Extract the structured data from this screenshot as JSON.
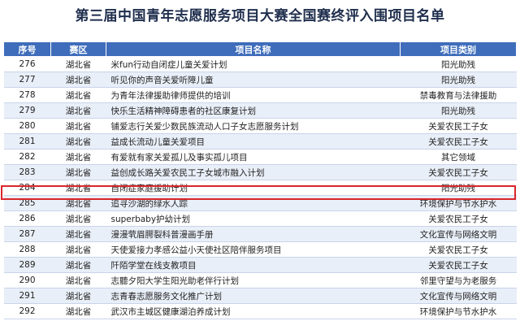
{
  "page": {
    "title": "第三届中国青年志愿服务项目大赛全国赛终评入围项目名单"
  },
  "table": {
    "headers": [
      "序号",
      "赛区",
      "项目名称",
      "项目类别"
    ],
    "rows": [
      [
        "276",
        "湖北省",
        "米fun行动自闭症儿童关爱计划",
        "阳光助残"
      ],
      [
        "277",
        "湖北省",
        "听见你的声音关爱听障儿童",
        "阳光助残"
      ],
      [
        "278",
        "湖北省",
        "为青年法律援助律师提供的培训",
        "禁毒教育与法律援助"
      ],
      [
        "279",
        "湖北省",
        "快乐生活精神障碍患者的社区康复计划",
        "阳光助残"
      ],
      [
        "280",
        "湖北省",
        "铺爱志行关爱少数民族流动人口子女志愿服务计划",
        "关爱农民工子女"
      ],
      [
        "281",
        "湖北省",
        "益成长流动儿童关爱项目",
        "关爱农民工子女"
      ],
      [
        "282",
        "湖北省",
        "有爱就有家关爱孤儿及事实孤儿项目",
        "其它领域"
      ],
      [
        "283",
        "湖北省",
        "益创成长路关爱农民工子女城市融入计划",
        "关爱农民工子女"
      ],
      [
        "284",
        "湖北省",
        "自闭症家庭援助计划",
        "阳光助残"
      ],
      [
        "285",
        "湖北省",
        "追寻沙湖的绿水人踪",
        "环境保护与节水护水"
      ],
      [
        "286",
        "湖北省",
        "superbaby护幼计划",
        "关爱农民工子女"
      ],
      [
        "287",
        "湖北省",
        "漫漫茕眉腭裂科普漫画手册",
        "文化宣传与网络文明"
      ],
      [
        "288",
        "湖北省",
        "天使爱接力孝感公益小天使社区陪伴服务项目",
        "关爱农民工子女"
      ],
      [
        "289",
        "湖北省",
        "阡陌学堂在线支教项目",
        "关爱农民工子女"
      ],
      [
        "290",
        "湖北省",
        "志聽夕阳大学生阳光助老伴行计划",
        "邻里守望与为老服务"
      ],
      [
        "291",
        "湖北省",
        "志青春志愿服务文化推广计划",
        "文化宣传与网络文明"
      ],
      [
        "292",
        "湖北省",
        "武汉市主城区健康湖泊养成计划",
        "环境保护与节水护水"
      ]
    ],
    "highlight_row": 8
  },
  "colors": {
    "header_bg": "#3f6dbb",
    "stripe": "#e9eff8",
    "highlight": "#d9262b"
  }
}
